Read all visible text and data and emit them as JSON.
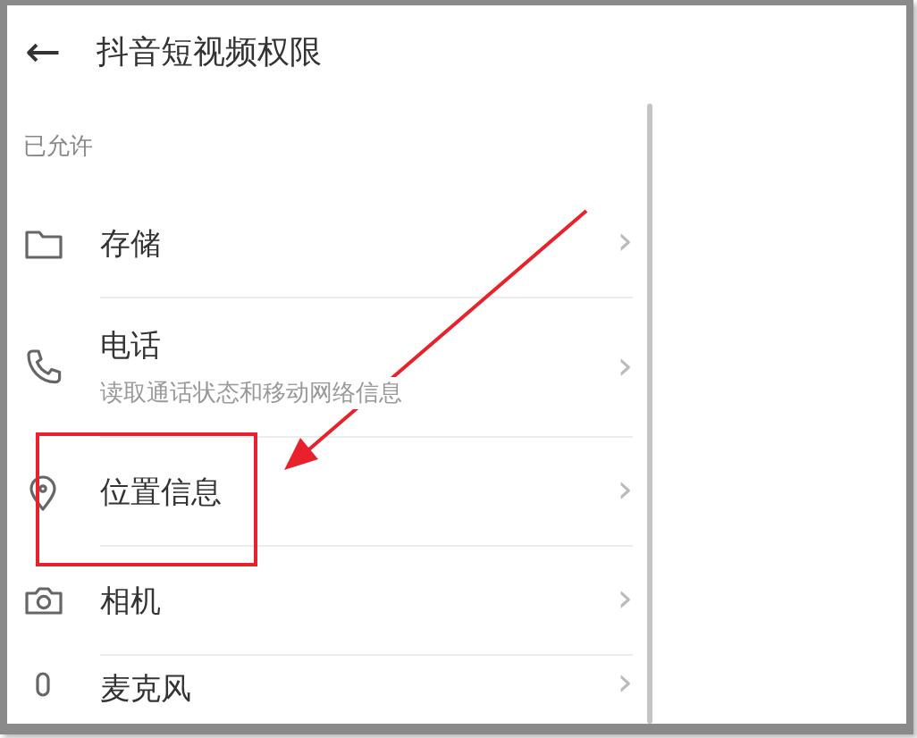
{
  "header": {
    "back": "←",
    "title": "抖音短视频权限"
  },
  "section": {
    "title": "已允许"
  },
  "permissions": [
    {
      "name": "存储",
      "chevron": "›"
    },
    {
      "name": "电话",
      "description": "读取通话状态和移动网络信息",
      "chevron": "›"
    },
    {
      "name": "位置信息",
      "chevron": "›"
    },
    {
      "name": "相机",
      "chevron": "›"
    },
    {
      "name": "麦克风",
      "chevron": "›"
    }
  ]
}
